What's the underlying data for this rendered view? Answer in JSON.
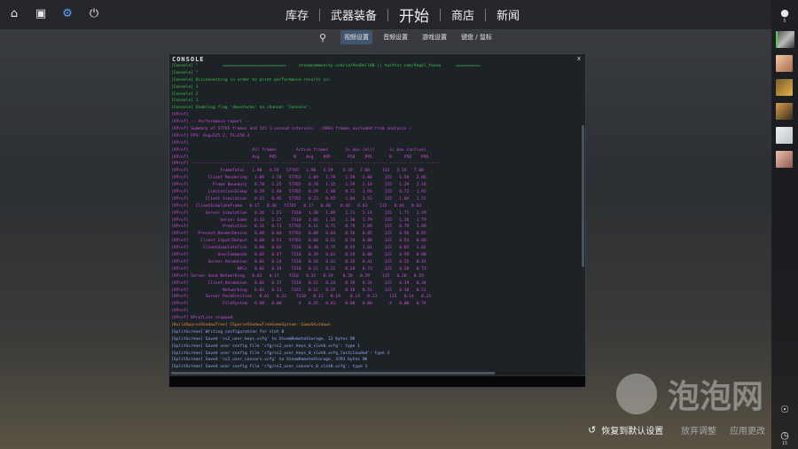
{
  "topbar": {
    "icons": [
      "home-icon",
      "inventory-icon",
      "settings-icon",
      "power-icon"
    ],
    "nav": [
      {
        "label": "库存"
      },
      {
        "label": "武器装备"
      },
      {
        "label": "开始"
      },
      {
        "label": "商店"
      },
      {
        "label": "新闻"
      }
    ]
  },
  "subnav": {
    "items": [
      {
        "label": "视频设置",
        "active": true
      },
      {
        "label": "音频设置"
      },
      {
        "label": "游戏设置"
      },
      {
        "label": "键盘 / 鼠标"
      }
    ]
  },
  "console": {
    "title": "CONSOLE",
    "close": "x",
    "lines": [
      {
        "t": "[Console] \"          ==========================     steamcommunity.com/id/AnnDell88 || twitter.com/Angel_foxxo      ==========",
        "c": "green"
      },
      {
        "t": "[Console] \"",
        "c": "green"
      },
      {
        "t": "[Console] Disconnecting in order to print performance results in:",
        "c": "green"
      },
      {
        "t": "[Console] 3",
        "c": "green"
      },
      {
        "t": "[Console] 2",
        "c": "green"
      },
      {
        "t": "[Console] 1",
        "c": "green"
      },
      {
        "t": "[Console] Enabling flag 'donotecho' on channel 'Console'.",
        "c": "green"
      },
      {
        "t": "[VProf]",
        "c": "magenta"
      },
      {
        "t": "[VProf] -- Performance report --",
        "c": "magenta"
      },
      {
        "t": "[VProf] Summary of 57765 frames and 115 1-second intervals.  (4843 frames excluded from analysis.)",
        "c": "magenta"
      },
      {
        "t": "[VProf] FPS: Avg=525.2, P1=250.4",
        "c": "magenta"
      },
      {
        "t": "[VProf]",
        "c": "magenta"
      },
      {
        "t": "[VProf]                          All frames        Active frames       1s max (all)      1s max (active)",
        "c": "magenta"
      },
      {
        "t": "[VProf]                          Avg    P95       N    Avg    P95       P50    P95       N     P50    P95",
        "c": "magenta"
      },
      {
        "t": "[VProf] ---------------------- ------ ------ ------- ------ ------ ------- ------ ------ ------- ------ ------",
        "c": "magenta"
      },
      {
        "t": "[VProf]             FrameTotal   1.90   4.59   57765   1.90   4.59    5.19   7.08     115   5.19   7.08",
        "c": "magenta"
      },
      {
        "t": "[VProf]        Client Rendering   1.09   1.78   57765   1.09   1.78    1.58   2.86     115   1.58   2.86",
        "c": "magenta"
      },
      {
        "t": "[VProf]          Frame Boundary   0.78   1.35   57765   0.78   1.35    1.29   2.18     115   1.29   2.18",
        "c": "magenta"
      },
      {
        "t": "[VProf]        LimitationsSleep   0.29   1.40   57765   0.29   1.40    0.72   1.93     115   0.72   1.93",
        "c": "magenta"
      },
      {
        "t": "[VProf]       Client Simulation   0.23   0.95   57765   0.23   0.95    1.04   1.51     115   1.04   1.51",
        "c": "magenta"
      },
      {
        "t": "[VProf]   ClientSimulateFrame   0.17   0.36   57765   0.17   0.36    0.44   0.63     115   0.44   0.63",
        "c": "magenta"
      },
      {
        "t": "[VProf]       Server Simulation   0.16   1.51    7310   1.30   1.89    1.71   2.19     115   1.71   2.19",
        "c": "magenta"
      },
      {
        "t": "[VProf]             Server Game   0.13   1.17    7310   1.05   1.35    1.36   1.79     115   1.36   1.79",
        "c": "magenta"
      },
      {
        "t": "[VProf]              Prediction   0.11   0.71   57765   0.11   0.71    0.79   1.09     115   0.79   1.09",
        "c": "magenta"
      },
      {
        "t": "[VProf]    Present_RenderDevice   0.09   0.04   57765   0.09   0.04    0.56   0.85     115   0.56   0.85",
        "c": "magenta"
      },
      {
        "t": "[VProf]     Client Input/Output   0.08   0.51   57765   0.08   0.51    0.54   0.86     115   0.54   0.86",
        "c": "magenta"
      },
      {
        "t": "[VProf]      ClientSimulateTick   0.06   0.62    7310   0.48   0.75    0.65   1.01     115   0.65   1.01",
        "c": "magenta"
      },
      {
        "t": "[VProf]            UserCommands   0.05   0.47    7310   0.39   0.63    0.59   0.80     115   0.59   0.80",
        "c": "magenta"
      },
      {
        "t": "[VProf]        Server Animation   0.02   0.24    7310   0.18   0.33    0.25   0.41     115   0.25   0.41",
        "c": "magenta"
      },
      {
        "t": "[VProf]                    NPCs   0.02   0.19    7310   0.15   0.22    0.20   0.73     115   0.20   0.73",
        "c": "magenta"
      },
      {
        "t": "[VProf] Server Send Networking   0.02   0.17    7310   0.15   0.19    0.20   0.29     115   0.20   0.29",
        "c": "magenta"
      },
      {
        "t": "[VProf]        Client_Animation   0.02   0.17    7310   0.15   0.24    0.19   0.34     115   0.19   0.34",
        "c": "magenta"
      },
      {
        "t": "[VProf]              Networking   0.01   0.13    7322   0.12   0.25    0.18   0.51     115   0.18   0.51",
        "c": "magenta"
      },
      {
        "t": "[VProf]       Server PackEntities   0.01   0.12    7310   0.11   0.19    0.14   0.23     115   0.14   0.23",
        "c": "magenta"
      },
      {
        "t": "[VProf]              FileSystem   0.00   0.00       4   0.25   0.83    0.00   0.00       4   0.00   0.74",
        "c": "magenta"
      },
      {
        "t": "[VProf]",
        "c": "magenta"
      },
      {
        "t": "[VProf] VProfLite stopped.",
        "c": "magenta"
      },
      {
        "t": "[BuildSparseShadowTree] CSparseShadowTreeGameSystem::GameShutdown",
        "c": "orange"
      },
      {
        "t": "[SplitScreen] Writing configuration for slot 0",
        "c": "blue"
      },
      {
        "t": "[SplitScreen] Saved 'cs2_user_keys.vcfg' to SteamRemoteStorage, 13 bytes OK",
        "c": "blue"
      },
      {
        "t": "[SplitScreen] Saved user config file 'cfg/cs2_user_keys_0_slot0.vcfg': type 1",
        "c": "blue"
      },
      {
        "t": "[SplitScreen] Saved user config file 'cfg/cs2_user_keys_0_slot0.vcfg_lastclouded': type 3",
        "c": "blue"
      },
      {
        "t": "[SplitScreen] Saved 'cs2_user_convars.vcfg' to SteamRemoteStorage, 3293 bytes OK",
        "c": "blue"
      },
      {
        "t": "[SplitScreen] Saved user config file 'cfg/cs2_user_convars_0_slot0.vcfg': type 1",
        "c": "blue"
      }
    ]
  },
  "rightbar": {
    "friend_count": "5",
    "bottom_count": "15"
  },
  "bottom": {
    "reset_label": "恢复到默认设置",
    "discard_label": "放弃调整",
    "apply_label": "应用更改"
  },
  "watermark": {
    "text": "泡泡网"
  }
}
